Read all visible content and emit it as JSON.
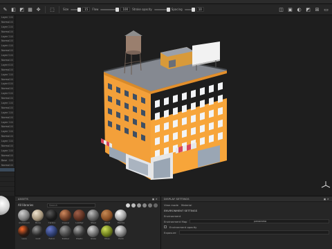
{
  "toolbar": {
    "size_label": "Size",
    "size_value": "15",
    "flow_label": "Flow",
    "flow_value": "100",
    "stroke_label": "Stroke opacity",
    "stroke_value": "100",
    "spacing_label": "Spacing",
    "spacing_value": "10"
  },
  "viewport": {
    "mode": "Material"
  },
  "layers": [
    {
      "label": "Layer 1",
      "pct": "100"
    },
    {
      "label": "Normal",
      "pct": "100"
    },
    {
      "label": "Layer 2",
      "pct": "100"
    },
    {
      "label": "Normal",
      "pct": "100"
    },
    {
      "label": "Layer 3",
      "pct": "100"
    },
    {
      "label": "Normal",
      "pct": "100"
    },
    {
      "label": "Layer 4",
      "pct": "100"
    },
    {
      "label": "Normal",
      "pct": "100"
    },
    {
      "label": "Layer 5",
      "pct": "100"
    },
    {
      "label": "Normal",
      "pct": "100"
    },
    {
      "label": "Layer 6",
      "pct": "100"
    },
    {
      "label": "Normal",
      "pct": "100"
    },
    {
      "label": "Layer 7",
      "pct": "100"
    },
    {
      "label": "Normal",
      "pct": "100"
    },
    {
      "label": "Layer 8",
      "pct": "100"
    },
    {
      "label": "Normal",
      "pct": "100"
    },
    {
      "label": "Layer 9",
      "pct": "100"
    },
    {
      "label": "Normal",
      "pct": "100"
    },
    {
      "label": "Layer 10",
      "pct": "100"
    },
    {
      "label": "Normal",
      "pct": "100"
    },
    {
      "label": "Layer 11",
      "pct": "100"
    },
    {
      "label": "Normal",
      "pct": "100"
    },
    {
      "label": "Layer 12",
      "pct": "100"
    },
    {
      "label": "Normal",
      "pct": "100"
    },
    {
      "label": "Layer 13",
      "pct": "100"
    },
    {
      "label": "Normal",
      "pct": "100"
    },
    {
      "label": "Layer 14",
      "pct": "100"
    },
    {
      "label": "Normal",
      "pct": "100"
    },
    {
      "label": "Layer 15",
      "pct": "100"
    },
    {
      "label": "Normal",
      "pct": "100"
    },
    {
      "label": "Base",
      "pct": "100"
    },
    {
      "label": "Normal",
      "pct": "100"
    },
    {
      "label": "",
      "pct": ""
    },
    {
      "label": "",
      "pct": ""
    },
    {
      "label": "",
      "pct": ""
    },
    {
      "label": "",
      "pct": ""
    },
    {
      "label": "",
      "pct": ""
    }
  ],
  "assets": {
    "title": "ASSETS",
    "library": "All libraries",
    "search_placeholder": "Search",
    "materials": [
      {
        "name": "Aluminium",
        "color": "#7d7d7d",
        "hl": "#d0d0d0"
      },
      {
        "name": "Bone",
        "color": "#a3937a",
        "hl": "#efe4cf"
      },
      {
        "name": "Carbon",
        "color": "#1a1a1a",
        "hl": "#5a5a5a"
      },
      {
        "name": "Copper",
        "color": "#6a3a24",
        "hl": "#d08a5e"
      },
      {
        "name": "Leather",
        "color": "#5a2f20",
        "hl": "#a0604a"
      },
      {
        "name": "Steel",
        "color": "#5a5a5a",
        "hl": "#bcbcbc"
      },
      {
        "name": "Wood",
        "color": "#8a4f25",
        "hl": "#c58a55"
      },
      {
        "name": "Marble",
        "color": "#9a9a9a",
        "hl": "#ffffff"
      },
      {
        "name": "Lava",
        "color": "#2a1a14",
        "hl": "#ff6a2a"
      },
      {
        "name": "Gold",
        "color": "#2a2a2a",
        "hl": "#9a9a9a"
      },
      {
        "name": "Fabric",
        "color": "#2a3a6a",
        "hl": "#6a7acc"
      },
      {
        "name": "Rubber",
        "color": "#444",
        "hl": "#9a9a9a"
      },
      {
        "name": "Plastic",
        "color": "#3a3a3a",
        "hl": "#b0b0b0"
      },
      {
        "name": "Glass",
        "color": "#6a6a6a",
        "hl": "#d8d8d8"
      },
      {
        "name": "Moss",
        "color": "#6a7a1a",
        "hl": "#cfe05a"
      },
      {
        "name": "Paint",
        "color": "#7a7a7a",
        "hl": "#f2f2f2"
      }
    ]
  },
  "display": {
    "title": "DISPLAY SETTINGS",
    "view_mode_label": "View mode",
    "view_mode_value": "Material",
    "environment_section": "ENVIRONMENT SETTINGS",
    "environment_label": "Environment",
    "env_map_label": "Environment Map",
    "env_map_value": "panorama",
    "opacity_label": "Environment opacity",
    "exposure_label": "Exposure"
  },
  "colors": {
    "building_main": "#f7a53a",
    "building_shade": "#d9842a",
    "roof": "#c8ccd4",
    "awning_red": "#d9455a"
  }
}
